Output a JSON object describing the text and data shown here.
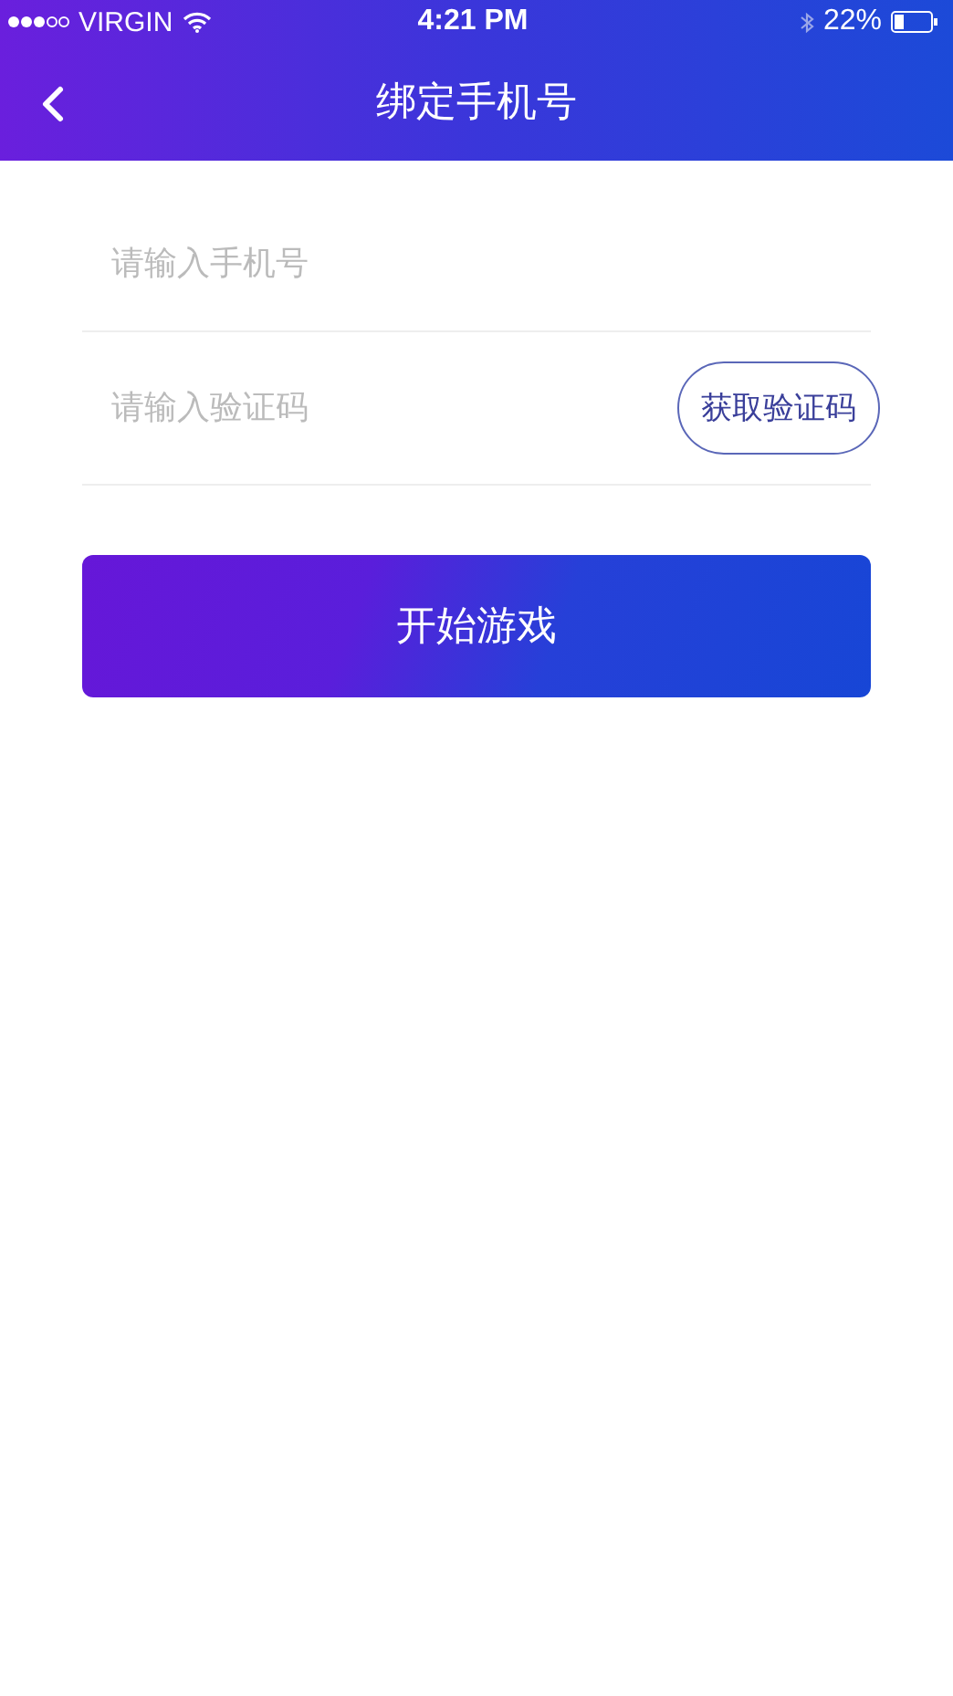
{
  "status_bar": {
    "carrier": "VIRGIN",
    "time": "4:21 PM",
    "battery": "22%"
  },
  "nav": {
    "title": "绑定手机号"
  },
  "form": {
    "phone": {
      "placeholder": "请输入手机号"
    },
    "code": {
      "placeholder": "请输入验证码"
    },
    "get_code_button": "获取验证码"
  },
  "submit_button": "开始游戏"
}
